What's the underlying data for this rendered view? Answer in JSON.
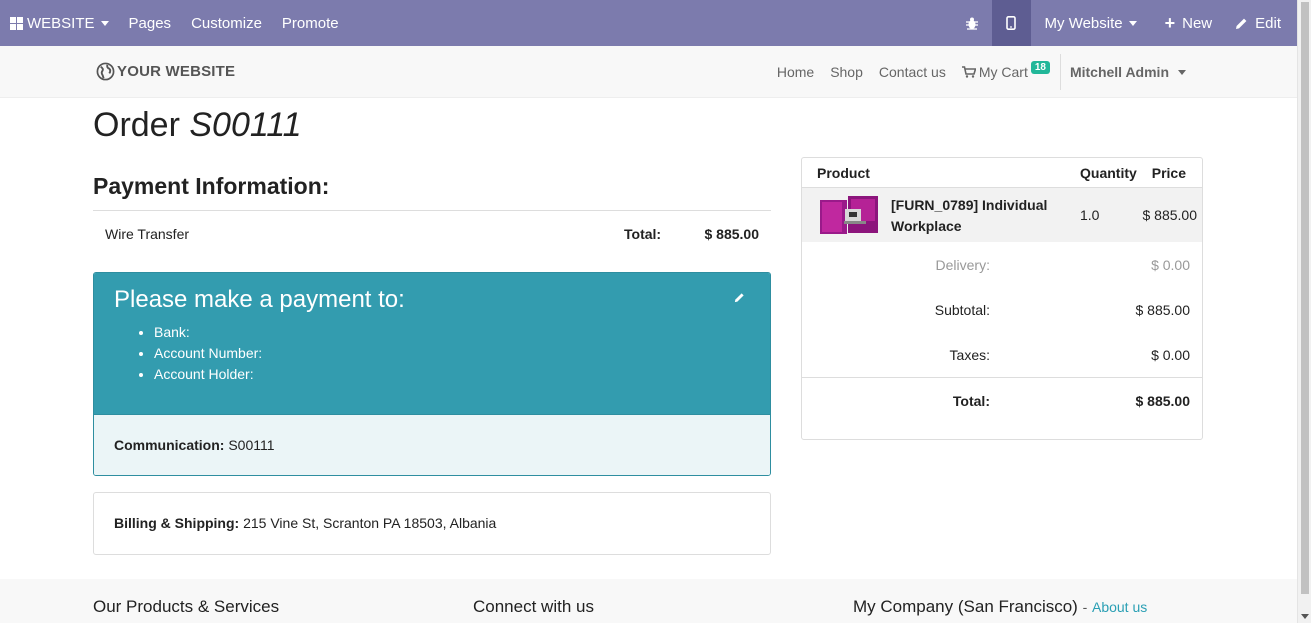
{
  "topbar": {
    "website_label": "WEBSITE",
    "pages_label": "Pages",
    "customize_label": "Customize",
    "promote_label": "Promote",
    "site_selector_label": "My Website",
    "new_label": "New",
    "edit_label": "Edit",
    "bg_color": "#7c7bad"
  },
  "header": {
    "logo_text": "YOUR WEBSITE",
    "nav": {
      "home": "Home",
      "shop": "Shop",
      "contact": "Contact us",
      "cart": "My Cart",
      "cart_count": "18",
      "user": "Mitchell Admin"
    }
  },
  "order": {
    "title_prefix": "Order",
    "number": "S00111"
  },
  "payment": {
    "heading": "Payment Information:",
    "method": "Wire Transfer",
    "total_label": "Total:",
    "total_value": "$ 885.00",
    "box_title": "Please make a payment to:",
    "details": [
      "Bank:",
      "Account Number:",
      "Account Holder:"
    ],
    "communication_label": "Communication:",
    "communication_value": "S00111"
  },
  "billing": {
    "label": "Billing & Shipping:",
    "address": "215 Vine St, Scranton PA 18503, Albania"
  },
  "summary": {
    "col_product": "Product",
    "col_quantity": "Quantity",
    "col_price": "Price",
    "item": {
      "name": "[FURN_0789] Individual Workplace",
      "qty": "1.0",
      "price": "$ 885.00"
    },
    "delivery_label": "Delivery:",
    "delivery_value": "$ 0.00",
    "subtotal_label": "Subtotal:",
    "subtotal_value": "$ 885.00",
    "taxes_label": "Taxes:",
    "taxes_value": "$ 0.00",
    "total_label": "Total:",
    "total_value": "$ 885.00"
  },
  "footer": {
    "col1": "Our Products & Services",
    "col2": "Connect with us",
    "col3": "My Company (San Francisco)",
    "col3_sep": "-",
    "about": "About us"
  }
}
